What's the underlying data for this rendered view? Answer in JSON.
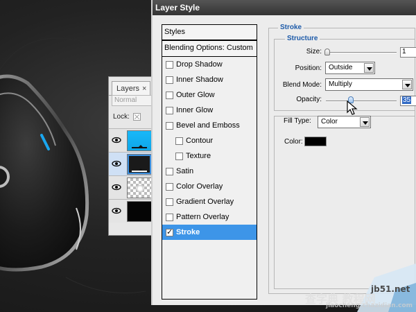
{
  "dialog": {
    "title": "Layer Style"
  },
  "styles_panel": {
    "header": "Styles",
    "blending_options": "Blending Options: Custom",
    "items": [
      {
        "label": "Drop Shadow",
        "checked": false,
        "sub": false,
        "active": false
      },
      {
        "label": "Inner Shadow",
        "checked": false,
        "sub": false,
        "active": false
      },
      {
        "label": "Outer Glow",
        "checked": false,
        "sub": false,
        "active": false
      },
      {
        "label": "Inner Glow",
        "checked": false,
        "sub": false,
        "active": false
      },
      {
        "label": "Bevel and Emboss",
        "checked": false,
        "sub": false,
        "active": false
      },
      {
        "label": "Contour",
        "checked": false,
        "sub": true,
        "active": false
      },
      {
        "label": "Texture",
        "checked": false,
        "sub": true,
        "active": false
      },
      {
        "label": "Satin",
        "checked": false,
        "sub": false,
        "active": false
      },
      {
        "label": "Color Overlay",
        "checked": false,
        "sub": false,
        "active": false
      },
      {
        "label": "Gradient Overlay",
        "checked": false,
        "sub": false,
        "active": false
      },
      {
        "label": "Pattern Overlay",
        "checked": false,
        "sub": false,
        "active": false
      },
      {
        "label": "Stroke",
        "checked": true,
        "sub": false,
        "active": true
      }
    ]
  },
  "stroke": {
    "group_title": "Stroke",
    "structure_title": "Structure",
    "size_label": "Size:",
    "size_value": "1",
    "position_label": "Position:",
    "position_value": "Outside",
    "blend_mode_label": "Blend Mode:",
    "blend_mode_value": "Multiply",
    "opacity_label": "Opacity:",
    "opacity_value": "35",
    "fill_type_label": "Fill Type:",
    "fill_type_value": "Color",
    "color_label": "Color:",
    "color_value": "#000000"
  },
  "layers_panel": {
    "tab_label": "Layers",
    "blend_placeholder": "Normal",
    "lock_label": "Lock:",
    "layers": [
      {
        "thumb": "blue",
        "selected": false
      },
      {
        "thumb": "dark",
        "selected": true
      },
      {
        "thumb": "transparent",
        "selected": false
      },
      {
        "thumb": "black",
        "selected": false
      }
    ]
  },
  "colors": {
    "accent_blue": "#3d95e8",
    "legend_blue": "#1c5aa8",
    "title_bar": "#3a3a3a",
    "glow_blue": "#1aa7f0"
  },
  "watermark": {
    "site": "jb51.net",
    "cn_line": "查字典 教程网",
    "sub": "jiaocheng.chazidian.com"
  }
}
